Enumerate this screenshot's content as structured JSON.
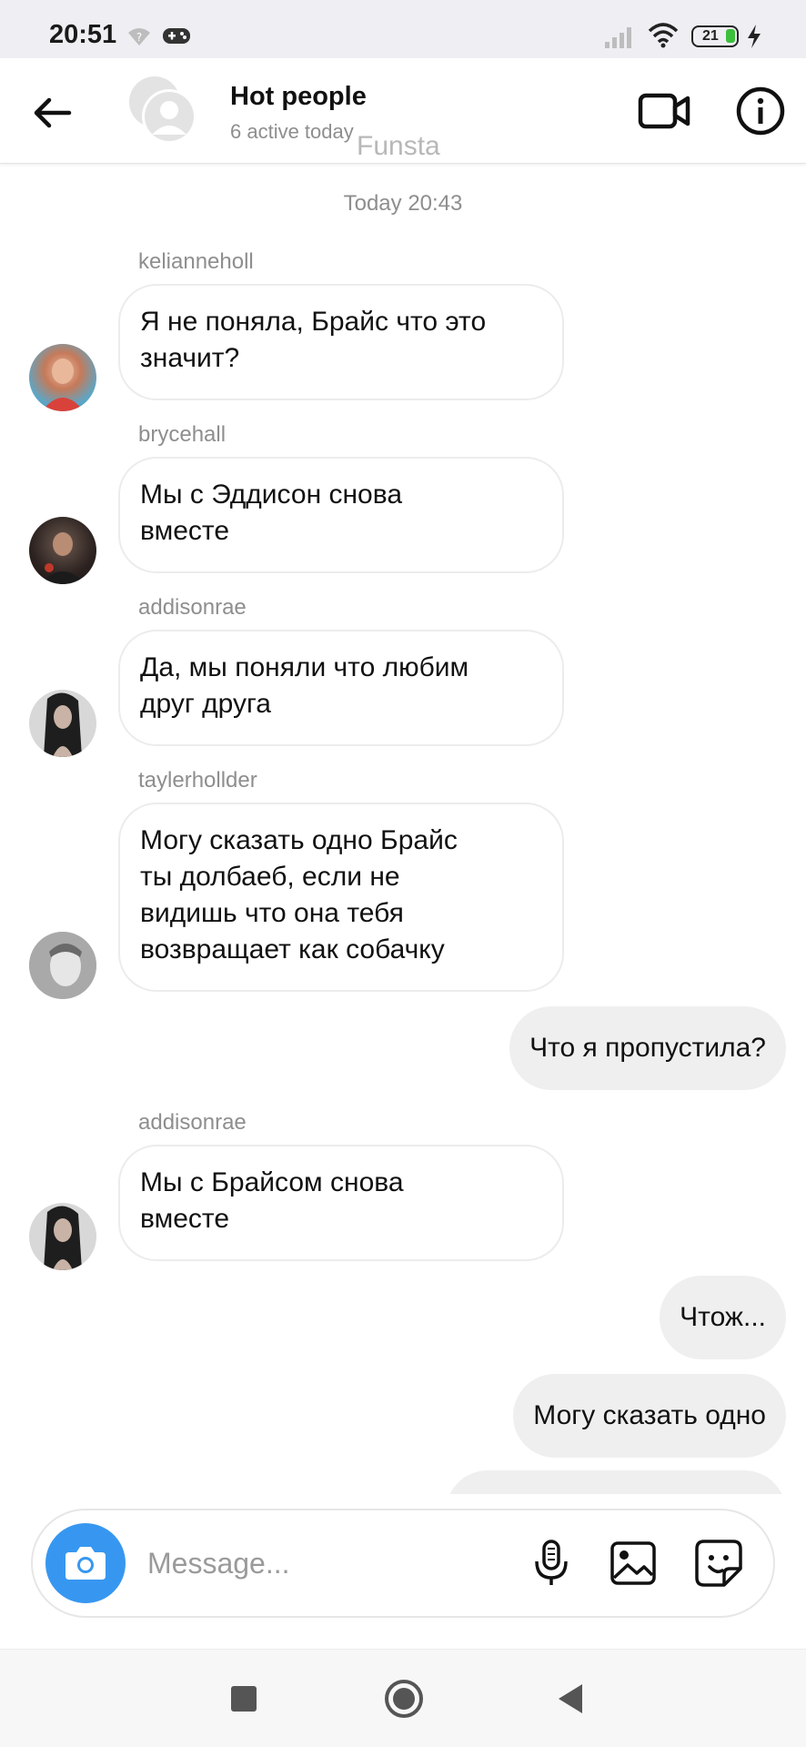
{
  "status_bar": {
    "time": "20:51",
    "battery": "21"
  },
  "header": {
    "title": "Hot people",
    "subtitle": "6 active today",
    "watermark": "Funsta"
  },
  "chat": {
    "timestamp": "Today 20:43",
    "messages": [
      {
        "sender": "kelianneholl",
        "lines": [
          "Я не поняла, Брайс что это",
          "значит?"
        ]
      },
      {
        "sender": "brycehall",
        "lines": [
          "Мы с Эддисон снова",
          "вместе"
        ]
      },
      {
        "sender": "addisonrae",
        "lines": [
          "Да, мы поняли что любим",
          "друг друга"
        ]
      },
      {
        "sender": "taylerhollder",
        "lines": [
          "Могу сказать одно Брайс",
          "ты долбаеб, если не",
          "видишь что она тебя",
          "возвращает как собачку"
        ]
      },
      {
        "outgoing": "Что я пропустила?"
      },
      {
        "sender": "addisonrae",
        "lines": [
          "Мы с Брайсом снова",
          "вместе"
        ]
      },
      {
        "outgoing": "Чтож..."
      },
      {
        "outgoing": "Могу сказать одно"
      }
    ]
  },
  "composer": {
    "placeholder": "Message..."
  },
  "colors": {
    "accent": "#3797f0",
    "outgoing_bubble": "#efefef",
    "muted_text": "#8e8e8e"
  },
  "icons": [
    "back-arrow-icon",
    "group-avatar-icon",
    "video-call-icon",
    "info-icon",
    "camera-icon",
    "microphone-icon",
    "gallery-icon",
    "sticker-icon",
    "recents-icon",
    "home-icon",
    "nav-back-icon",
    "wifi-icon",
    "gamepad-icon",
    "battery-icon",
    "charging-icon"
  ]
}
